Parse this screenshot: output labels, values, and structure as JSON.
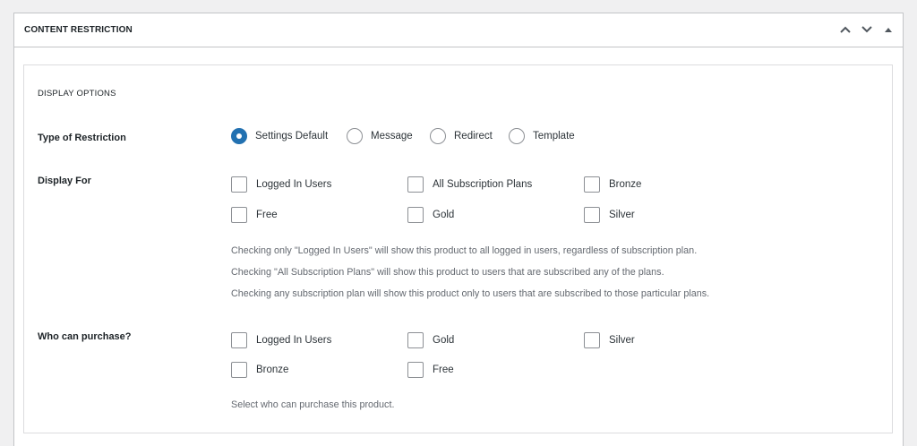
{
  "box": {
    "title": "CONTENT RESTRICTION",
    "controls": [
      "chevron-up-icon",
      "chevron-down-icon",
      "caret-up-icon"
    ]
  },
  "display_options": {
    "heading": "DISPLAY OPTIONS",
    "type_of_restriction": {
      "label": "Type of Restriction",
      "options": [
        {
          "label": "Settings Default",
          "checked": true
        },
        {
          "label": "Message",
          "checked": false
        },
        {
          "label": "Redirect",
          "checked": false
        },
        {
          "label": "Template",
          "checked": false
        }
      ]
    },
    "display_for": {
      "label": "Display For",
      "options": [
        {
          "label": "Logged In Users",
          "checked": false
        },
        {
          "label": "All Subscription Plans",
          "checked": false
        },
        {
          "label": "Bronze",
          "checked": false
        },
        {
          "label": "Free",
          "checked": false
        },
        {
          "label": "Gold",
          "checked": false
        },
        {
          "label": "Silver",
          "checked": false
        }
      ],
      "help": [
        "Checking only \"Logged In Users\" will show this product to all logged in users, regardless of subscription plan.",
        "Checking \"All Subscription Plans\" will show this product to users that are subscribed any of the plans.",
        "Checking any subscription plan will show this product only to users that are subscribed to those particular plans."
      ]
    },
    "who_can_purchase": {
      "label": "Who can purchase?",
      "options": [
        {
          "label": "Logged In Users",
          "checked": false
        },
        {
          "label": "Gold",
          "checked": false
        },
        {
          "label": "Silver",
          "checked": false
        },
        {
          "label": "Bronze",
          "checked": false
        },
        {
          "label": "Free",
          "checked": false
        }
      ],
      "help": "Select who can purchase this product."
    }
  },
  "colors": {
    "accent": "#2271b1",
    "border": "#c3c4c7",
    "help_text": "#646970"
  }
}
